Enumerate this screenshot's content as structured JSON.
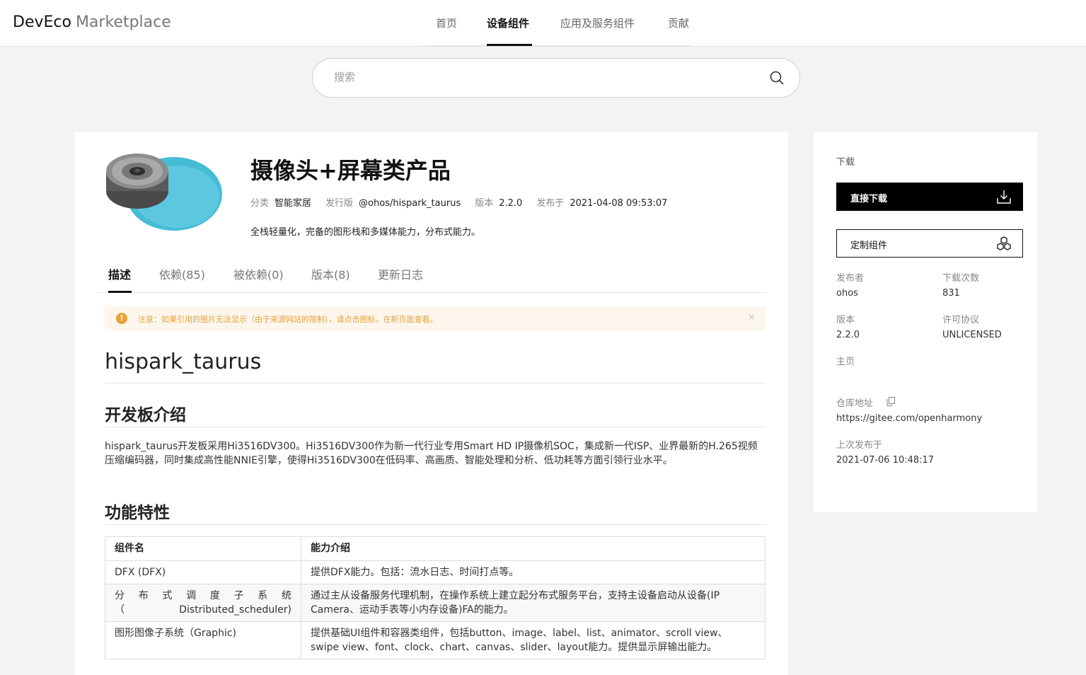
{
  "header": {
    "brand_main": "DevEco",
    "brand_sub": "Marketplace",
    "nav": [
      "首页",
      "设备组件",
      "应用及服务组件",
      "贡献"
    ],
    "active_nav": "设备组件"
  },
  "search": {
    "placeholder": "搜索",
    "icon": "search-icon"
  },
  "product": {
    "title": "摄像头+屏幕类产品",
    "meta": {
      "category_label": "分类",
      "category": "智能家居",
      "release_label": "发行版",
      "release": "@ohos/hispark_taurus",
      "version_label": "版本",
      "version": "2.2.0",
      "published_label": "发布于",
      "published": "2021-04-08 09:53:07"
    },
    "summary": "全栈轻量化，完备的图形栈和多媒体能力，分布式能力。"
  },
  "tabs": [
    "描述",
    "依赖(85)",
    "被依赖(0)",
    "版本(8)",
    "更新日志"
  ],
  "active_tab": "描述",
  "notice": {
    "text": "注意：如果引用的图片无法显示（由于来源网站的限制），请点击图标，在新页面查看。",
    "close": "×",
    "color": "#e6a23c"
  },
  "content": {
    "h1": "hispark_taurus",
    "h2_board": "开发板介绍",
    "board_text": "hispark_taurus开发板采用Hi3516DV300。Hi3516DV300作为新一代行业专用Smart HD IP摄像机SOC，集成新一代ISP、业界最新的H.265视频压缩编码器，同时集成高性能NNIE引擎，使得Hi3516DV300在低码率、高画质、智能处理和分析、低功耗等方面引领行业水平。",
    "h2_features": "功能特性",
    "table": {
      "headers": [
        "组件名",
        "能力介绍"
      ],
      "rows": [
        [
          "DFX (DFX)",
          "提供DFX能力。包括：流水日志、时间打点等。"
        ],
        [
          "分布式调度子系统（Distributed_scheduler)",
          "通过主从设备服务代理机制，在操作系统上建立起分布式服务平台，支持主设备启动从设备(IP Camera、运动手表等小内存设备)FA的能力。"
        ],
        [
          "图形图像子系统（Graphic)",
          "提供基础UI组件和容器类组件，包括button、image、label、list、animator、scroll view、swipe view、font、clock、chart、canvas、slider、layout能力。提供显示屏输出能力。"
        ]
      ]
    }
  },
  "sidebar": {
    "title": "下载",
    "download_button": "直接下载",
    "custom_button": "定制组件",
    "publisher_label": "发布者",
    "publisher": "ohos",
    "downloads_label": "下载次数",
    "downloads": "831",
    "version_label": "版本",
    "version": "2.2.0",
    "license_label": "许可协议",
    "license": "UNLICENSED",
    "homepage_label": "主页",
    "repo_label": "仓库地址",
    "repo": "https://gitee.com/openharmony",
    "last_published_label": "上次发布于",
    "last_published": "2021-07-06 10:48:17"
  }
}
